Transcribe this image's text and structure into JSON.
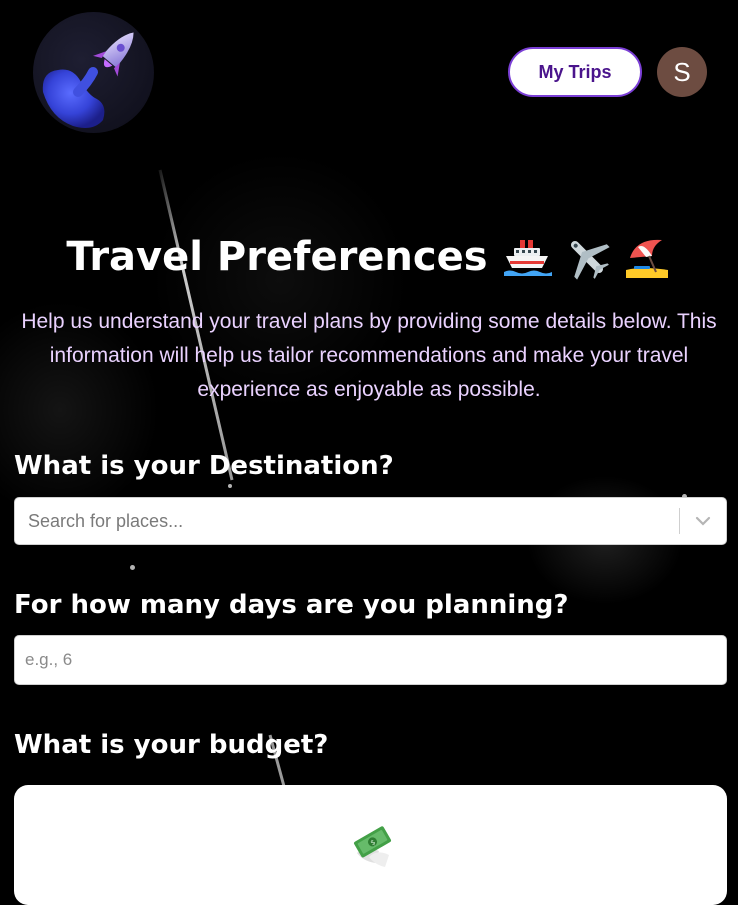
{
  "header": {
    "logo_icon": "rocket-logo-icon",
    "my_trips_label": "My Trips",
    "avatar_initial": "S",
    "avatar_color": "#6d4c41",
    "accent_color": "#7b3fd6"
  },
  "hero": {
    "title": "Travel Preferences",
    "emojis": [
      "ship-icon",
      "airplane-icon",
      "beach-umbrella-icon"
    ],
    "subtitle": "Help us understand your travel plans by providing some details below. This information will help us tailor recommendations and make your travel experience as enjoyable as possible."
  },
  "destination": {
    "question": "What is your Destination?",
    "placeholder": "Search for places..."
  },
  "days": {
    "question": "For how many days are you planning?",
    "placeholder": "e.g., 6"
  },
  "budget": {
    "question": "What is your budget?",
    "first_option_icon": "money-with-wings-icon"
  }
}
